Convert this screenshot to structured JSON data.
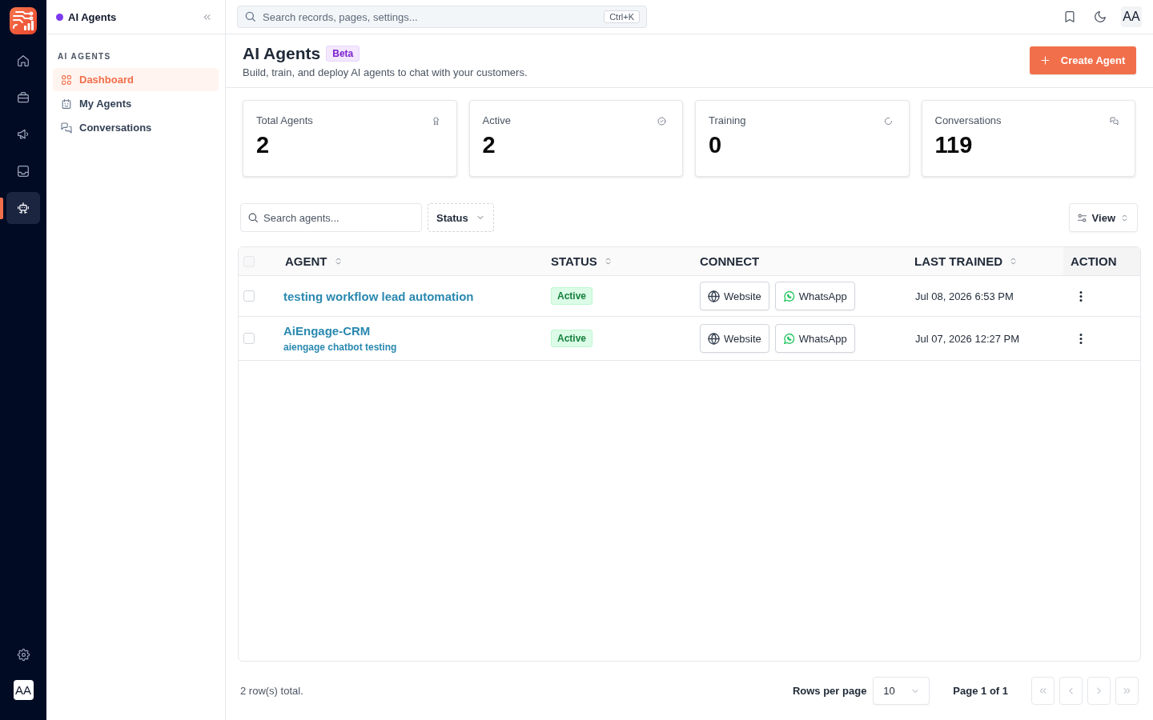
{
  "rail": {
    "items": [
      {
        "selected": false
      },
      {
        "selected": false
      },
      {
        "selected": false
      },
      {
        "selected": false
      },
      {
        "selected": true
      }
    ],
    "avatar": "AA"
  },
  "sidebar": {
    "title": "AI Agents",
    "section": "AI AGENTS",
    "items": [
      {
        "label": "Dashboard",
        "selected": true
      },
      {
        "label": "My Agents",
        "selected": false
      },
      {
        "label": "Conversations",
        "selected": false
      }
    ]
  },
  "topbar": {
    "search": {
      "placeholder": "Search records, pages, settings...",
      "shortcut": "Ctrl+K"
    },
    "avatar": "AA"
  },
  "header": {
    "title": "AI Agents",
    "badge": "Beta",
    "subtitle": "Build, train, and deploy AI agents to chat with your customers.",
    "action": "Create Agent"
  },
  "stats": [
    {
      "label": "Total Agents",
      "value": "2"
    },
    {
      "label": "Active",
      "value": "2"
    },
    {
      "label": "Training",
      "value": "0"
    },
    {
      "label": "Conversations",
      "value": "119"
    }
  ],
  "toolbar": {
    "search": {
      "placeholder": "Search agents..."
    },
    "filter": "Status",
    "view": "View"
  },
  "table": {
    "select_all": {
      "checked": false
    },
    "columns": [
      {
        "label": "AGENT",
        "sortable": true
      },
      {
        "label": "STATUS",
        "sortable": true
      },
      {
        "label": "CONNECT",
        "sortable": false
      },
      {
        "label": "LAST TRAINED",
        "sortable": true
      },
      {
        "label": "ACTION",
        "sortable": false
      }
    ],
    "rows": [
      {
        "checked": false,
        "name": "testing workflow lead automation",
        "status": "Active",
        "connect": [
          {
            "kind": "web",
            "label": "Website"
          },
          {
            "kind": "whatsapp",
            "label": "WhatsApp"
          }
        ],
        "last_trained": "Jul 08, 2026 6:53 PM"
      },
      {
        "checked": false,
        "name": "AiEngage-CRM",
        "description": "aiengage chatbot testing",
        "status": "Active",
        "connect": [
          {
            "kind": "web",
            "label": "Website"
          },
          {
            "kind": "whatsapp",
            "label": "WhatsApp"
          }
        ],
        "last_trained": "Jul 07, 2026 12:27 PM"
      }
    ]
  },
  "footer": {
    "total": "2 row(s) total.",
    "rows_per_page_label": "Rows per page",
    "rows_per_page": "10",
    "page": "Page 1 of 1",
    "pager_buttons": [
      {
        "disabled": true
      },
      {
        "disabled": true
      },
      {
        "disabled": true
      },
      {
        "disabled": true
      }
    ]
  }
}
